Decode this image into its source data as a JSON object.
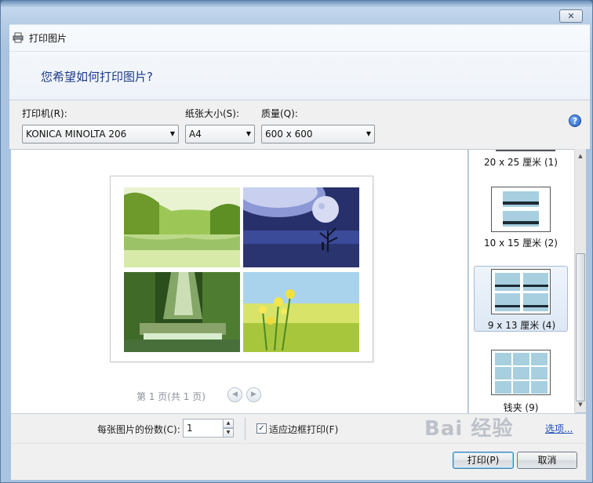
{
  "window": {
    "title": "打印图片",
    "close_glyph": "✕"
  },
  "header": {
    "question": "您希望如何打印图片?"
  },
  "printer": {
    "label": "打印机(R):",
    "value": "KONICA MINOLTA 206"
  },
  "paper_size": {
    "label": "纸张大小(S):",
    "value": "A4"
  },
  "quality": {
    "label": "质量(Q):",
    "value": "600 x 600"
  },
  "help": {
    "glyph": "?"
  },
  "preview": {
    "page_indicator": "第 1 页(共 1 页)",
    "prev_glyph": "◀",
    "next_glyph": "▶",
    "photos": [
      {
        "name": "lake-forest",
        "colors": [
          "#cfe6a0",
          "#7fb23a",
          "#9bc86b",
          "#e8f2b8"
        ]
      },
      {
        "name": "moon-night",
        "colors": [
          "#2b3a7a",
          "#6b77c8",
          "#c9d4f0",
          "#1b244f"
        ]
      },
      {
        "name": "waterfall-jungle",
        "colors": [
          "#2f5a1e",
          "#8ab55a",
          "#d8eec0",
          "#4b6d2f"
        ]
      },
      {
        "name": "rapeseed-field",
        "colors": [
          "#a8cfe8",
          "#e6e85a",
          "#5f9a2c",
          "#f2f08a"
        ]
      }
    ]
  },
  "layouts": [
    {
      "label": "20 x 25 厘米 (1)",
      "selected": false
    },
    {
      "label": "10 x 15 厘米 (2)",
      "selected": false
    },
    {
      "label": "9 x 13 厘米 (4)",
      "selected": true
    },
    {
      "label": "钱夹 (9)",
      "selected": false
    }
  ],
  "copies": {
    "label": "每张图片的份数(C):",
    "value": "1"
  },
  "fit_frame": {
    "label": "适应边框打印(F)",
    "checked": true,
    "check_glyph": "✓"
  },
  "options_link": "选项...",
  "buttons": {
    "print": "打印(P)",
    "cancel": "取消"
  },
  "watermark": "Bai 经验"
}
